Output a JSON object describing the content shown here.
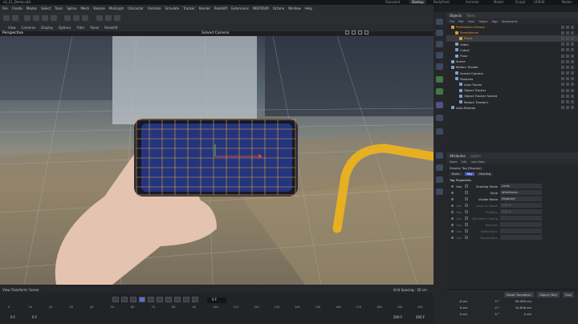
{
  "window": {
    "title": "s3_11_Demo.c4d",
    "workspaces": [
      "Standard",
      "Startup",
      "BodyPaint",
      "Animate",
      "Model",
      "Sculpt",
      "UVEdit",
      "Nodes"
    ],
    "active_workspace": "Startup"
  },
  "menubar": [
    "File",
    "Create",
    "Modes",
    "Select",
    "Tools",
    "Spline",
    "Mesh",
    "Volume",
    "MoGraph",
    "Character",
    "Animate",
    "Simulate",
    "Tracker",
    "Render",
    "Redshift",
    "Extensions",
    "INSYDIUM",
    "Octane",
    "Window",
    "Help"
  ],
  "viewport": {
    "menu": [
      "View",
      "Cameras",
      "Display",
      "Options",
      "Filter",
      "Panel",
      "Redshift"
    ],
    "label": "Perspective",
    "camera": "Solved Camera",
    "status_left": "View Transform: Scene",
    "status_right": "Grid Spacing : 50 cm"
  },
  "objects": {
    "tabs": [
      "Objects",
      "Takes"
    ],
    "menu": [
      "File",
      "Edit",
      "View",
      "Object",
      "Tags",
      "Bookmarks"
    ],
    "rows": [
      {
        "name": "Perforation Groups",
        "color": "orange",
        "indent": 0
      },
      {
        "name": "Smartphone",
        "color": "orange",
        "indent": 1
      },
      {
        "name": "Plane",
        "color": "orange",
        "indent": 2,
        "selected": true
      },
      {
        "name": "Video",
        "color": "normal",
        "indent": 1
      },
      {
        "name": "Cube1",
        "color": "normal",
        "indent": 1
      },
      {
        "name": "Floor",
        "color": "normal",
        "indent": 1
      },
      {
        "name": "Scene",
        "color": "normal",
        "indent": 0
      },
      {
        "name": "Motion Tracker",
        "color": "normal",
        "indent": 0
      },
      {
        "name": "Solved Camera",
        "color": "normal",
        "indent": 1
      },
      {
        "name": "Features",
        "color": "normal",
        "indent": 1
      },
      {
        "name": "Auto Tracks",
        "color": "normal",
        "indent": 2
      },
      {
        "name": "Object Tracker",
        "color": "normal",
        "indent": 2
      },
      {
        "name": "Object Tracker Solved",
        "color": "normal",
        "indent": 2
      },
      {
        "name": "Motion Tracker1",
        "color": "normal",
        "indent": 2
      },
      {
        "name": "Auto Redraw",
        "color": "normal",
        "indent": 0
      }
    ]
  },
  "attributes": {
    "tabs": [
      "Attributes",
      "Layers"
    ],
    "menu": [
      "Mode",
      "Edit",
      "User Data"
    ],
    "header": "Display Tag [Display]",
    "subtabs": [
      "Basic",
      "Tag",
      "Shading"
    ],
    "active_subtab": "Tag",
    "section": "Tag Properties",
    "rows": [
      {
        "label": "Use",
        "name": "Shading Mode",
        "value": "Lines",
        "enabled": true
      },
      {
        "label": "",
        "name": "Style",
        "value": "Wireframe",
        "enabled": true
      },
      {
        "label": "",
        "name": "Visible Mode",
        "value": "Disabled",
        "enabled": true
      },
      {
        "label": "Use",
        "name": "Level of Detail",
        "value": "100 %",
        "enabled": false
      },
      {
        "label": "Use",
        "name": "Visibility",
        "value": "100 %",
        "enabled": false
      },
      {
        "label": "Use",
        "name": "Backface Culling",
        "value": "",
        "enabled": false
      },
      {
        "label": "Use",
        "name": "Textures",
        "value": "",
        "enabled": false
      },
      {
        "label": "Use",
        "name": "Reflections",
        "value": "",
        "enabled": false
      },
      {
        "label": "Use",
        "name": "Tessellation",
        "value": "",
        "enabled": false
      }
    ]
  },
  "timeline": {
    "current_frame": "0 F",
    "ruler": [
      "0",
      "10",
      "20",
      "30",
      "40",
      "50",
      "60",
      "70",
      "80",
      "90",
      "100",
      "110",
      "120",
      "130",
      "140",
      "150",
      "160",
      "170",
      "180",
      "190",
      "200"
    ],
    "start": "0 F",
    "start2": "0 F",
    "end": "200 F",
    "end2": "200 F"
  },
  "coordinates": {
    "buttons": [
      "Reset Transform",
      "Object (Rel)",
      "Size"
    ],
    "rows": [
      {
        "p": "0 cm",
        "r": "0 °",
        "s": "30.559 cm"
      },
      {
        "p": "0 cm",
        "r": "0 °",
        "s": "14.618 cm"
      },
      {
        "p": "0 cm",
        "r": "0 °",
        "s": "0 cm"
      }
    ]
  }
}
